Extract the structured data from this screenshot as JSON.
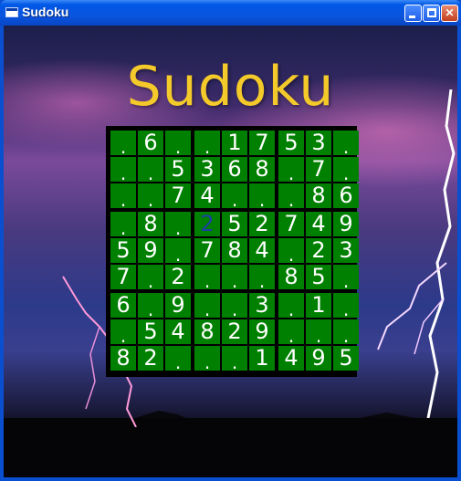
{
  "window": {
    "title": "Sudoku",
    "controls": {
      "minimize": "minimize",
      "maximize": "maximize",
      "close": "✕"
    }
  },
  "game": {
    "heading": "Sudoku",
    "grid": [
      [
        ".",
        "6",
        ".",
        ".",
        "1",
        "7",
        "5",
        "3",
        "."
      ],
      [
        ".",
        ".",
        "5",
        "3",
        "6",
        "8",
        ".",
        "7",
        "."
      ],
      [
        ".",
        ".",
        "7",
        "4",
        ".",
        ".",
        ".",
        "8",
        "6"
      ],
      [
        ".",
        "8",
        ".",
        "2",
        "5",
        "2",
        "7",
        "4",
        "9"
      ],
      [
        "5",
        "9",
        ".",
        "7",
        "8",
        "4",
        ".",
        "2",
        "3"
      ],
      [
        "7",
        ".",
        "2",
        ".",
        ".",
        ".",
        "8",
        "5",
        "."
      ],
      [
        "6",
        ".",
        "9",
        ".",
        ".",
        "3",
        ".",
        "1",
        "."
      ],
      [
        ".",
        "5",
        "4",
        "8",
        "2",
        "9",
        ".",
        ".",
        "."
      ],
      [
        "8",
        "2",
        ".",
        ".",
        ".",
        "1",
        "4",
        "9",
        "5"
      ]
    ],
    "selected_cell": {
      "row": 3,
      "col": 3
    },
    "colors": {
      "cell_background": "#008000",
      "given_digit": "#ffffff",
      "selected_digit": "#1c3fa8",
      "grid_lines": "#000000",
      "heading": "#f4c92a"
    }
  }
}
